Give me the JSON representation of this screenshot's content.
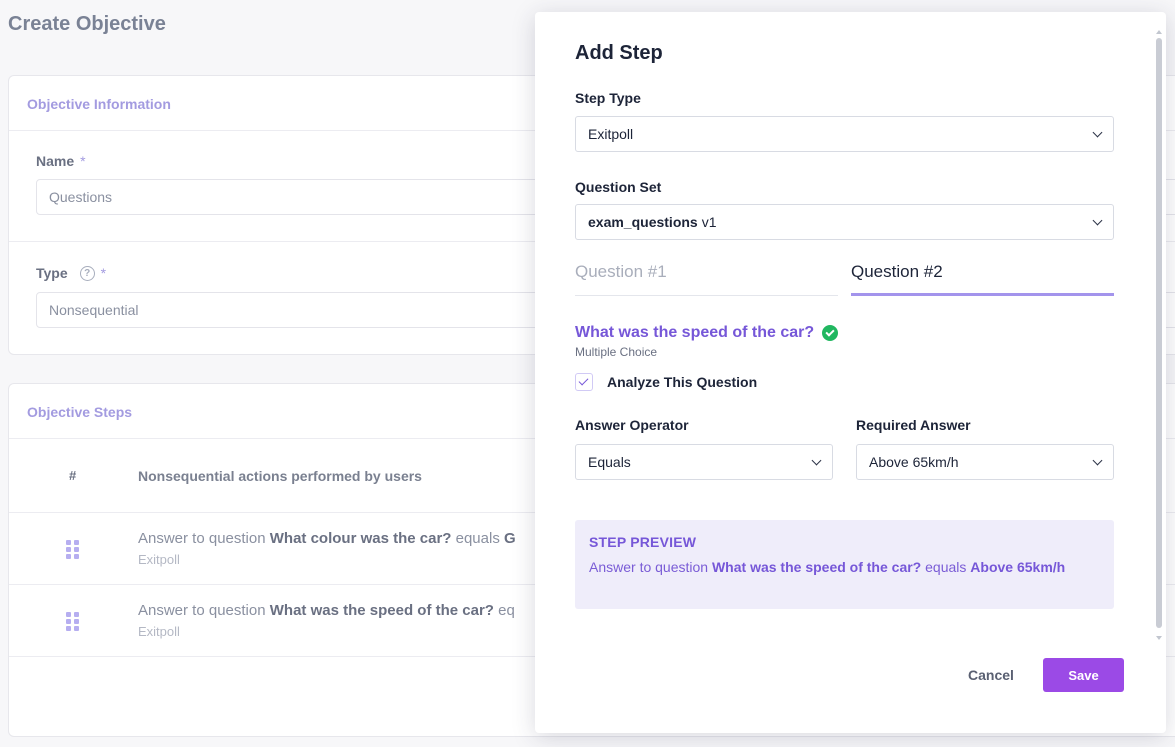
{
  "page": {
    "title": "Create Objective"
  },
  "objective_info": {
    "header": "Objective Information",
    "name_label": "Name",
    "required_mark": "*",
    "name_value": "Questions",
    "type_label": "Type",
    "type_help": "?",
    "type_value": "Nonsequential"
  },
  "objective_steps": {
    "header": "Objective Steps",
    "col_hash": "#",
    "col_title": "Nonsequential actions performed by users",
    "rows": [
      {
        "prefix": "Answer to question ",
        "question": "What colour was the car?",
        "middle": " equals ",
        "answer": "G",
        "type": "Exitpoll"
      },
      {
        "prefix": "Answer to question ",
        "question": "What was the speed of the car?",
        "middle": " eq",
        "answer": "",
        "type": "Exitpoll"
      }
    ]
  },
  "modal": {
    "title": "Add Step",
    "step_type_label": "Step Type",
    "step_type_value": "Exitpoll",
    "question_set_label": "Question Set",
    "question_set_name": "exam_questions",
    "question_set_version": "v1",
    "tabs": [
      {
        "label": "Question #1",
        "active": false
      },
      {
        "label": "Question #2",
        "active": true
      }
    ],
    "question_title": "What was the speed of the car?",
    "question_type": "Multiple Choice",
    "analyze_label": "Analyze This Question",
    "analyze_checked": true,
    "answer_operator_label": "Answer Operator",
    "answer_operator_value": "Equals",
    "required_answer_label": "Required Answer",
    "required_answer_value": "Above 65km/h",
    "preview_title": "STEP PREVIEW",
    "preview_prefix": "Answer to question ",
    "preview_question": "What was the speed of the car?",
    "preview_middle": " equals ",
    "preview_answer": "Above 65km/h",
    "cancel_label": "Cancel",
    "save_label": "Save"
  },
  "colors": {
    "accent": "#7657d8",
    "save_button": "#9b4ae6",
    "success": "#21b760",
    "preview_bg": "#efedfa"
  },
  "icons": {
    "chevron": "chevron-down-icon",
    "check": "check-circle-icon",
    "help": "question-circle-icon",
    "grip": "drag-handle-icon"
  }
}
